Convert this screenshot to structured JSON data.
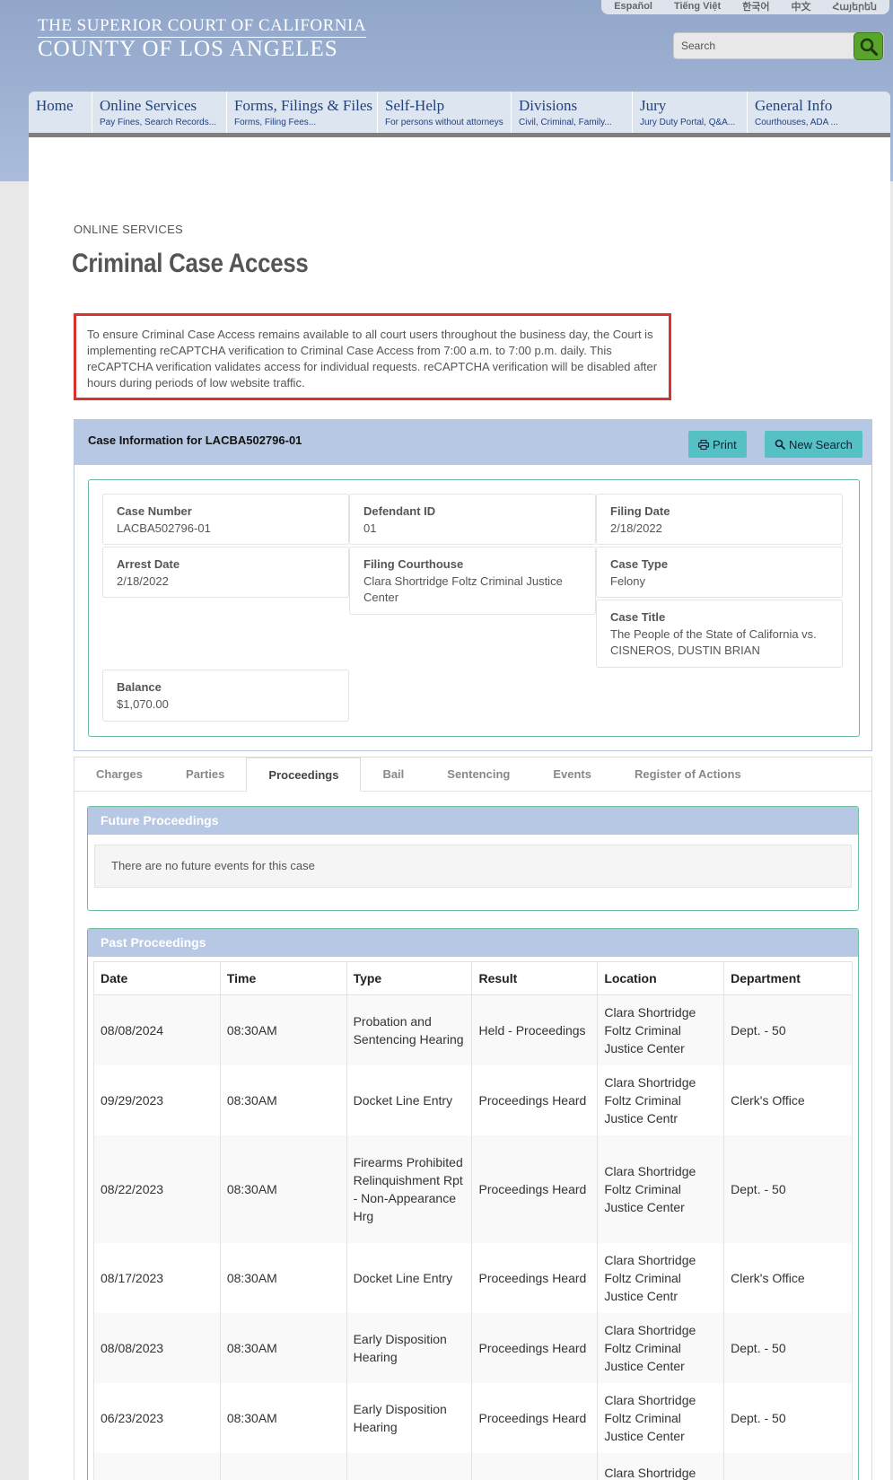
{
  "header": {
    "languages": [
      "Español",
      "Tiếng Việt",
      "한국어",
      "中文",
      "Հայերեն"
    ],
    "court_line1": "THE SUPERIOR COURT OF CALIFORNIA",
    "court_line2": "COUNTY OF LOS ANGELES",
    "search_placeholder": "Search"
  },
  "nav": [
    {
      "title": "Home",
      "sub": ""
    },
    {
      "title": "Online Services",
      "sub": "Pay Fines, Search Records..."
    },
    {
      "title": "Forms, Filings & Files",
      "sub": "Forms, Filing Fees..."
    },
    {
      "title": "Self-Help",
      "sub": "For persons without attorneys"
    },
    {
      "title": "Divisions",
      "sub": "Civil, Criminal, Family..."
    },
    {
      "title": "Jury",
      "sub": "Jury Duty Portal, Q&A..."
    },
    {
      "title": "General Info",
      "sub": "Courthouses, ADA ..."
    }
  ],
  "page": {
    "breadcrumb": "ONLINE SERVICES",
    "title": "Criminal Case Access",
    "notice": "To ensure Criminal Case Access remains available to all court users throughout the business day, the Court is implementing reCAPTCHA verification to Criminal Case Access from 7:00 a.m. to 7:00 p.m. daily. This reCAPTCHA verification validates access for individual requests. reCAPTCHA verification will be disabled after hours during periods of low website traffic."
  },
  "case": {
    "header": "Case Information for LACBA502796-01",
    "print_label": "Print",
    "new_search_label": "New Search",
    "fields": {
      "case_number": {
        "label": "Case Number",
        "value": "LACBA502796-01"
      },
      "defendant_id": {
        "label": "Defendant ID",
        "value": "01"
      },
      "filing_date": {
        "label": "Filing Date",
        "value": "2/18/2022"
      },
      "arrest_date": {
        "label": "Arrest Date",
        "value": "2/18/2022"
      },
      "filing_courthouse": {
        "label": "Filing Courthouse",
        "value": "Clara Shortridge Foltz Criminal Justice Center"
      },
      "case_type": {
        "label": "Case Type",
        "value": "Felony"
      },
      "case_title": {
        "label": "Case Title",
        "value": "The People of the State of California vs. CISNEROS, DUSTIN BRIAN"
      },
      "balance": {
        "label": "Balance",
        "value": "$1,070.00"
      }
    }
  },
  "tabs": [
    "Charges",
    "Parties",
    "Proceedings",
    "Bail",
    "Sentencing",
    "Events",
    "Register of Actions"
  ],
  "active_tab": "Proceedings",
  "future": {
    "title": "Future Proceedings",
    "empty_text": "There are no future events for this case"
  },
  "past": {
    "title": "Past Proceedings",
    "columns": [
      "Date",
      "Time",
      "Type",
      "Result",
      "Location",
      "Department"
    ],
    "rows": [
      [
        "08/08/2024",
        "08:30AM",
        "Probation and Sentencing Hearing",
        "Held - Proceedings",
        "Clara Shortridge Foltz Criminal Justice Center",
        "Dept. - 50"
      ],
      [
        "09/29/2023",
        "08:30AM",
        "Docket Line Entry",
        "Proceedings Heard",
        "Clara Shortridge Foltz Criminal Justice Centr",
        "Clerk's Office"
      ],
      [
        "08/22/2023",
        "08:30AM",
        "Firearms Prohibited Relinquishment Rpt - Non-Appearance Hrg",
        "Proceedings Heard",
        "Clara Shortridge Foltz Criminal Justice Center",
        "Dept. - 50"
      ],
      [
        "08/17/2023",
        "08:30AM",
        "Docket Line Entry",
        "Proceedings Heard",
        "Clara Shortridge Foltz Criminal Justice Centr",
        "Clerk's Office"
      ],
      [
        "08/08/2023",
        "08:30AM",
        "Early Disposition Hearing",
        "Proceedings Heard",
        "Clara Shortridge Foltz Criminal Justice Center",
        "Dept. - 50"
      ],
      [
        "06/23/2023",
        "08:30AM",
        "Early Disposition Hearing",
        "Proceedings Heard",
        "Clara Shortridge Foltz Criminal Justice Center",
        "Dept. - 50"
      ],
      [
        "",
        "",
        "",
        "",
        "Clara Shortridge",
        ""
      ]
    ]
  }
}
